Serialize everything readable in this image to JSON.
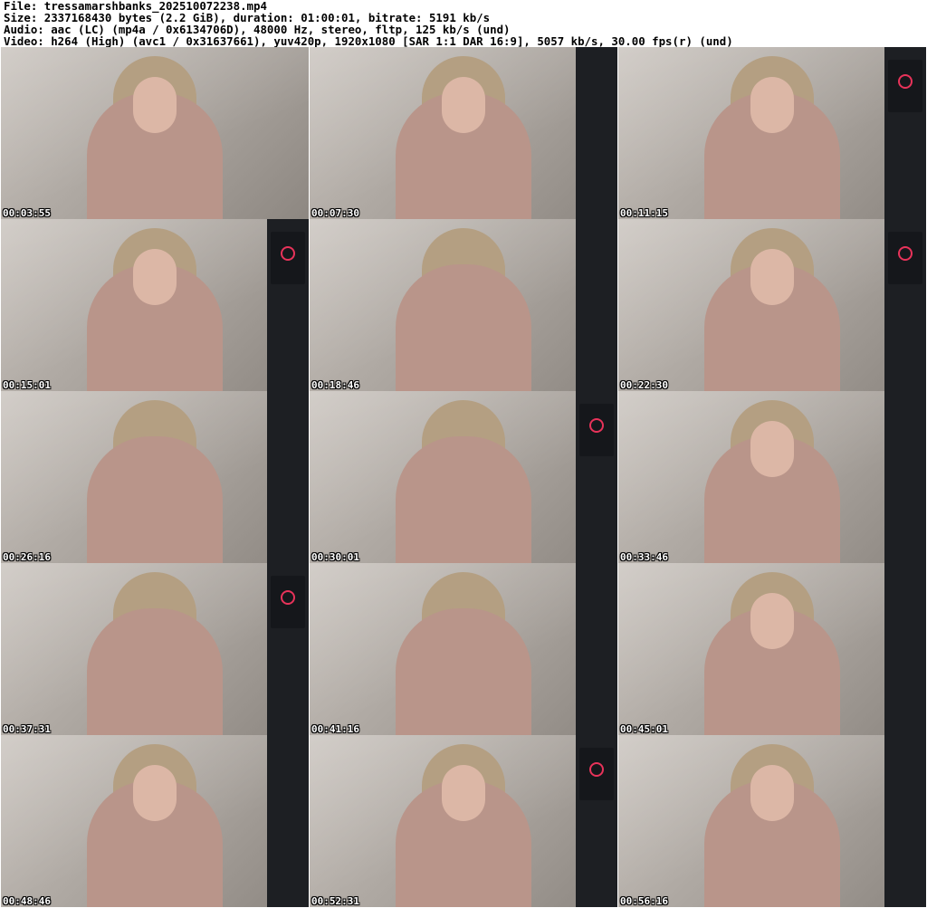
{
  "header": {
    "file": "File: tressamarshbanks_202510072238.mp4",
    "size": "Size: 2337168430 bytes (2.2 GiB), duration: 01:00:01, bitrate: 5191 kb/s",
    "audio": "Audio: aac (LC) (mp4a / 0x6134706D), 48000 Hz, stereo, fltp, 125 kb/s (und)",
    "video": "Video: h264 (High) (avc1 / 0x31637661), yuv420p, 1920x1080 [SAR 1:1 DAR 16:9], 5057 kb/s, 30.00 fps(r) (und)"
  },
  "thumbnails": [
    {
      "timestamp": "00:03:55"
    },
    {
      "timestamp": "00:07:30"
    },
    {
      "timestamp": "00:11:15"
    },
    {
      "timestamp": "00:15:01"
    },
    {
      "timestamp": "00:18:46"
    },
    {
      "timestamp": "00:22:30"
    },
    {
      "timestamp": "00:26:16"
    },
    {
      "timestamp": "00:30:01"
    },
    {
      "timestamp": "00:33:46"
    },
    {
      "timestamp": "00:37:31"
    },
    {
      "timestamp": "00:41:16"
    },
    {
      "timestamp": "00:45:01"
    },
    {
      "timestamp": "00:48:46"
    },
    {
      "timestamp": "00:52:31"
    },
    {
      "timestamp": "00:56:16"
    }
  ],
  "colors": {
    "background": "#ffffff",
    "header_text": "#000000",
    "timestamp_text": "#ffffff",
    "curtain": "#1d1f23",
    "accent": "#e8335a"
  }
}
